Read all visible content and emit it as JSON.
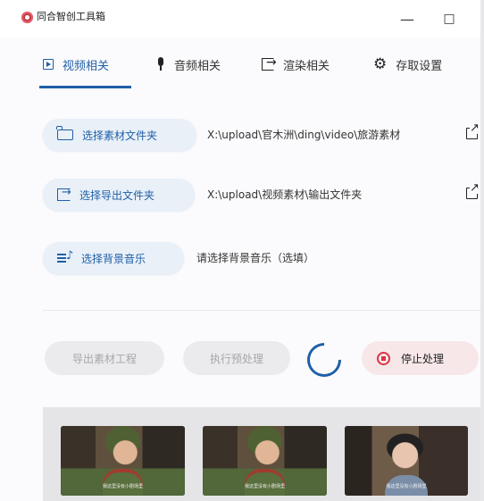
{
  "window": {
    "title": "同合智创工具箱",
    "minimize_label": "—",
    "maximize_label": "□",
    "accent_color": "#1f5fa8",
    "stop_color": "#d93446"
  },
  "tabs": [
    {
      "label": "视频相关",
      "icon": "play-box-icon",
      "active": true
    },
    {
      "label": "音频相关",
      "icon": "microphone-icon",
      "active": false
    },
    {
      "label": "渲染相关",
      "icon": "export-arrow-icon",
      "active": false
    },
    {
      "label": "存取设置",
      "icon": "gear-icon",
      "active": false
    }
  ],
  "settings": {
    "material_folder": {
      "button_label": "选择素材文件夹",
      "path": "X:\\upload\\官木洲\\ding\\video\\旅游素材",
      "icon": "folder-icon",
      "open_icon": "open-external-icon"
    },
    "export_folder": {
      "button_label": "选择导出文件夹",
      "path": "X:\\upload\\视频素材\\输出文件夹",
      "icon": "export-icon",
      "open_icon": "open-external-icon"
    },
    "background_music": {
      "button_label": "选择背景音乐",
      "path": "请选择背景音乐（选填）",
      "icon": "music-list-icon"
    }
  },
  "actions": {
    "export_project_label": "导出素材工程",
    "preprocess_label": "执行预处理",
    "loading_icon": "loading-spinner-icon",
    "stop_label": "停止处理",
    "stop_icon": "stop-icon"
  },
  "thumbnails": [
    {
      "subtitle": "我这里没有小剧场里"
    },
    {
      "subtitle": "我这里没有小剧场里"
    },
    {
      "subtitle": "我这里没有小剧场里"
    }
  ]
}
